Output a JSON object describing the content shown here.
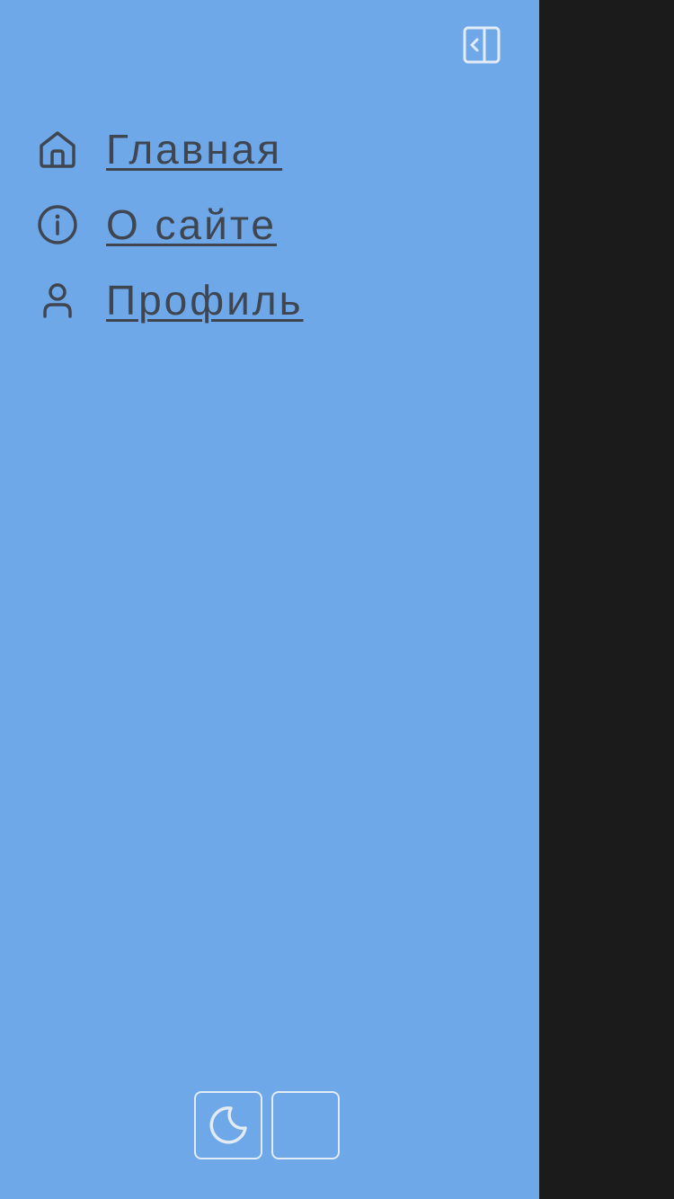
{
  "sidebar": {
    "collapse_icon": "sidebar-collapse-icon",
    "nav": [
      {
        "label": "Главная",
        "icon": "home-icon"
      },
      {
        "label": "О сайте",
        "icon": "info-icon"
      },
      {
        "label": "Профиль",
        "icon": "user-icon"
      }
    ],
    "controls": [
      {
        "icon": "moon-icon"
      },
      {
        "icon": ""
      }
    ]
  },
  "colors": {
    "sidebar_bg": "#6fa8e9",
    "overlay_bg": "#1b1b1b",
    "nav_text": "#3f4650",
    "icon_light": "#e3ebf5"
  }
}
